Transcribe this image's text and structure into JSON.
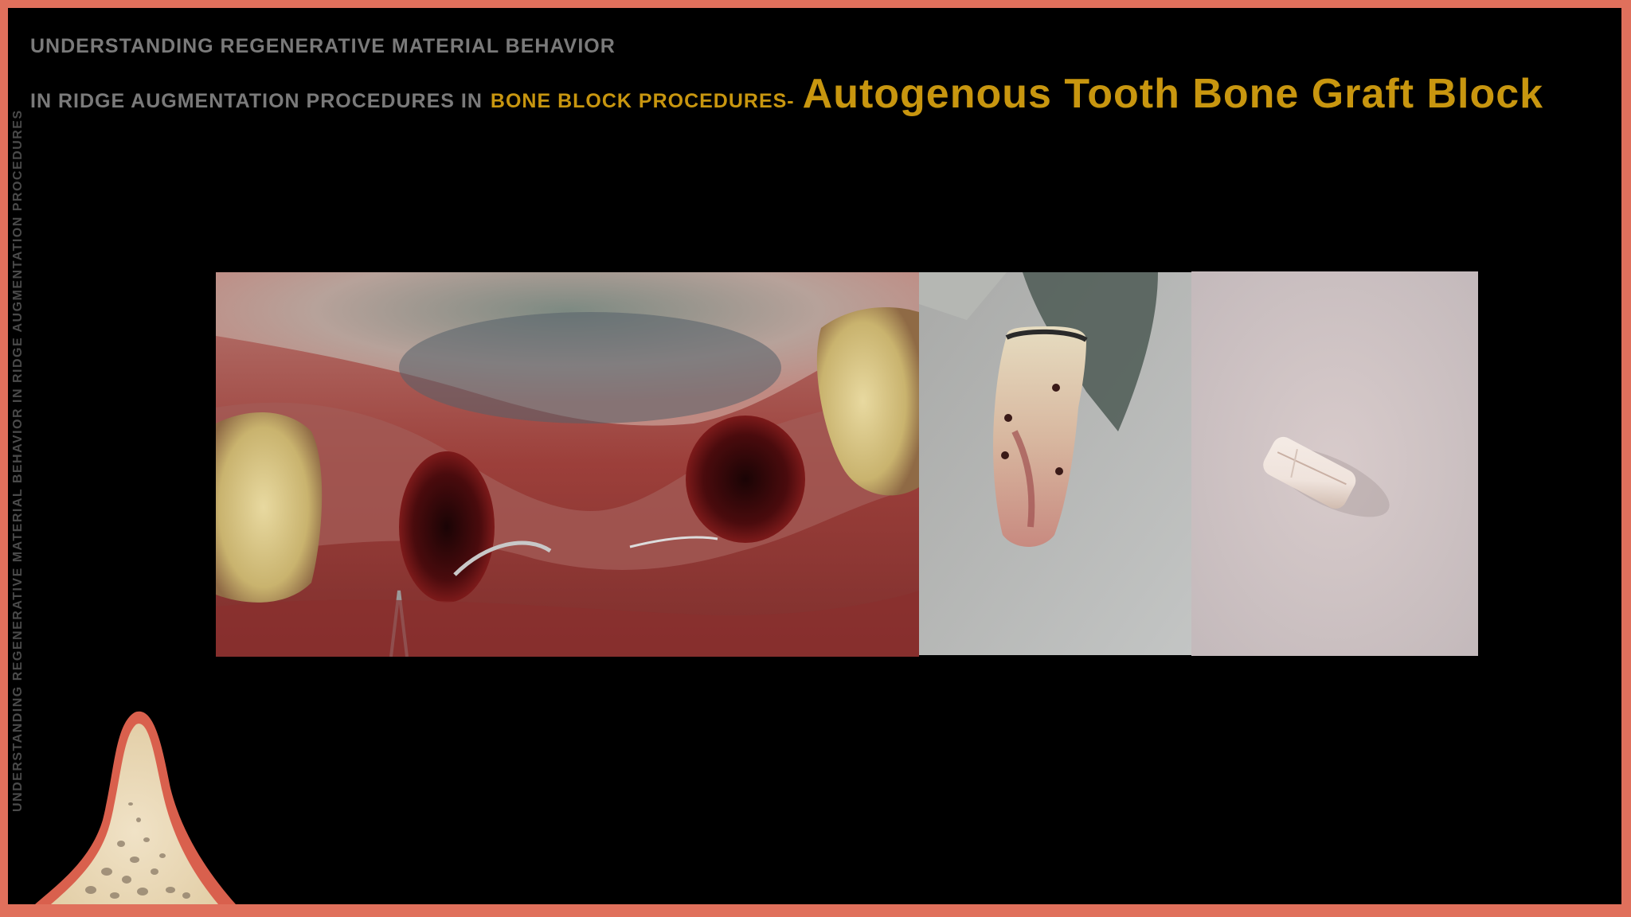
{
  "header": {
    "line1": "UNDERSTANDING REGENERATIVE MATERIAL BEHAVIOR",
    "line2_grey": "IN RIDGE AUGMENTATION PROCEDURES IN",
    "line2_gold": "BONE BLOCK PROCEDURES-",
    "line2_title": "Autogenous Tooth Bone Graft Block"
  },
  "sidebar": {
    "vertical_text": "UNDERSTANDING REGENERATIVE MATERIAL BEHAVIOR IN RIDGE AUGMENTATION PROCEDURES"
  },
  "images": [
    {
      "name": "surgical-site-photo"
    },
    {
      "name": "extracted-tooth-photo"
    },
    {
      "name": "tooth-graft-block-photo"
    }
  ],
  "colors": {
    "frame": "#e0705c",
    "background": "#000000",
    "accent_gold": "#c8960f",
    "text_grey": "#7a7a7a"
  },
  "icons": [
    "bone-ridge-logo"
  ]
}
